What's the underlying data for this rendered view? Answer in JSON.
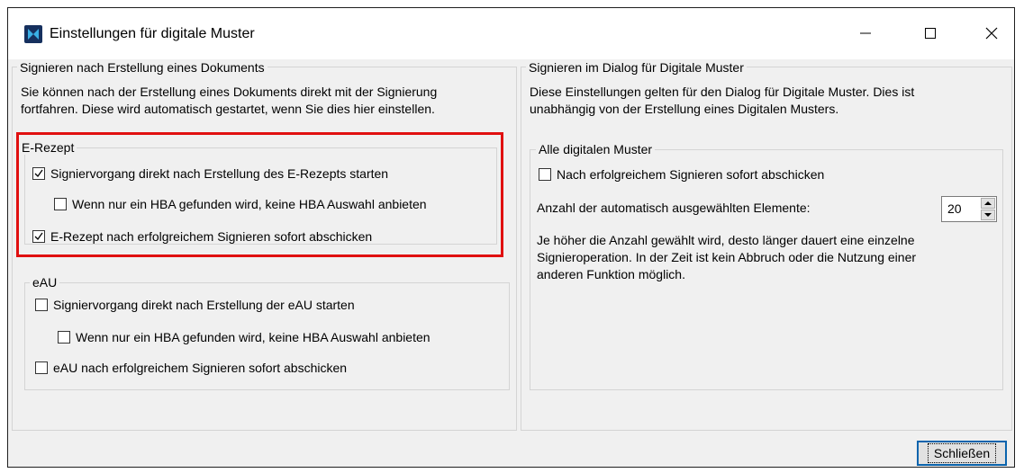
{
  "window": {
    "title": "Einstellungen für digitale Muster",
    "controls": {
      "minimize": "—",
      "maximize": "☐",
      "close": "✕"
    }
  },
  "left_panel": {
    "legend": "Signieren nach Erstellung eines Dokuments",
    "description_line1": "Sie können nach der Erstellung eines Dokuments direkt mit der Signierung",
    "description_line2": "fortfahren. Diese wird automatisch gestartet, wenn Sie dies hier einstellen.",
    "erezept": {
      "legend": "E-Rezept",
      "items": [
        {
          "label": "Signiervorgang direkt nach Erstellung des E-Rezepts starten",
          "checked": true
        },
        {
          "label": "Wenn nur ein HBA gefunden wird, keine HBA Auswahl anbieten",
          "checked": false
        },
        {
          "label": "E-Rezept nach erfolgreichem Signieren sofort abschicken",
          "checked": true
        }
      ]
    },
    "eau": {
      "legend": "eAU",
      "items": [
        {
          "label": "Signiervorgang direkt nach Erstellung der eAU starten",
          "checked": false
        },
        {
          "label": "Wenn nur ein HBA gefunden wird, keine HBA Auswahl anbieten",
          "checked": false
        },
        {
          "label": "eAU nach erfolgreichem Signieren sofort abschicken",
          "checked": false
        }
      ]
    }
  },
  "right_panel": {
    "legend": "Signieren im Dialog für Digitale Muster",
    "description_line1": "Diese Einstellungen gelten für den Dialog für Digitale Muster. Dies ist",
    "description_line2": "unabhängig von der Erstellung eines Digitalen Musters.",
    "all_muster": {
      "legend": "Alle digitalen Muster",
      "send_immediately": {
        "label": "Nach erfolgreichem Signieren sofort abschicken",
        "checked": false
      },
      "count_label": "Anzahl der automatisch ausgewählten Elemente:",
      "count_value": "20",
      "info_line1": "Je höher die Anzahl gewählt wird, desto länger dauert eine einzelne",
      "info_line2": "Signieroperation. In der Zeit ist kein Abbruch oder die Nutzung einer",
      "info_line3": "anderen Funktion möglich."
    }
  },
  "footer": {
    "close_button": "Schließen"
  },
  "colors": {
    "highlight": "#e01010",
    "accent": "#0a64ad",
    "icon_bg": "#16305e"
  }
}
